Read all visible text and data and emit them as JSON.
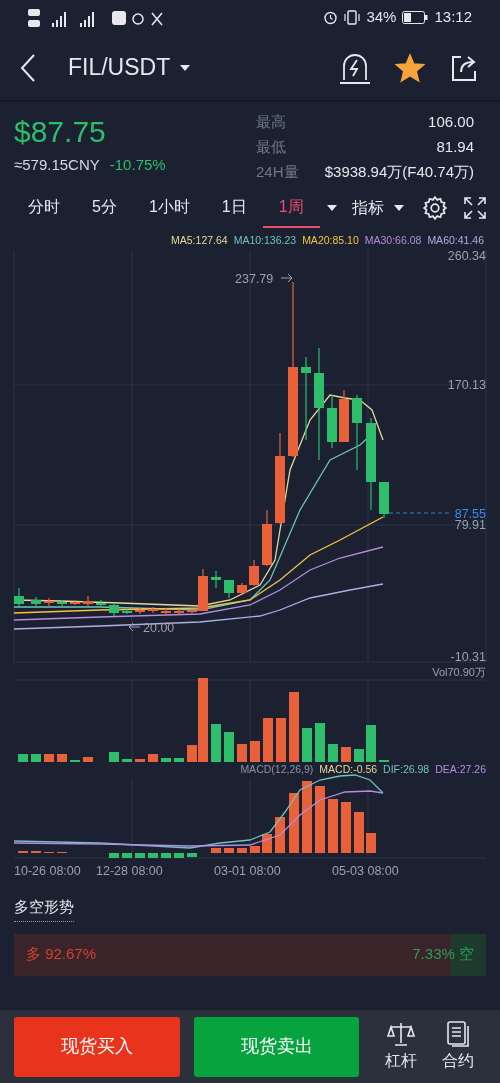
{
  "status_bar": {
    "battery": "34%",
    "time": "13:12"
  },
  "header": {
    "pair": "FIL/USDT",
    "favorite": true
  },
  "price": {
    "last": "$87.75",
    "cny": "≈579.15CNY",
    "change": "-10.75%"
  },
  "stats": [
    {
      "label": "最高",
      "value": "106.00"
    },
    {
      "label": "最低",
      "value": "81.94"
    },
    {
      "label": "24H量",
      "value": "$3938.94万(F40.74万)"
    }
  ],
  "timeframes": [
    {
      "label": "分时",
      "selected": false
    },
    {
      "label": "5分",
      "selected": false
    },
    {
      "label": "1小时",
      "selected": false
    },
    {
      "label": "1日",
      "selected": false
    },
    {
      "label": "1周",
      "selected": true
    }
  ],
  "indicator_menu": "指标",
  "chart": {
    "ma_legend": [
      {
        "label": "MA5:127.64",
        "color": "#e3d99a"
      },
      {
        "label": "MA10:136.23",
        "color": "#6fc3b8"
      },
      {
        "label": "MA20:85.10",
        "color": "#f5c342"
      },
      {
        "label": "MA30:66.08",
        "color": "#b48ce0"
      },
      {
        "label": "MA60:41.46",
        "color": "#aab0e0"
      }
    ],
    "price_axis": [
      "260.34",
      "170.13",
      "79.91",
      "-10.31"
    ],
    "high_marker": "237.79",
    "low_marker": "20.00",
    "current_price": "87.55",
    "volume_label": "Vol70.90万",
    "macd_legend": [
      {
        "label": "MACD(12,26,9)",
        "color": "#8a93a6"
      },
      {
        "label": "MACD:-0.56",
        "color": "#e3d99a"
      },
      {
        "label": "DIF:26.98",
        "color": "#6fc3b8"
      },
      {
        "label": "DEA:27.26",
        "color": "#b48ce0"
      }
    ],
    "time_axis": [
      "10-26 08:00",
      "12-28 08:00",
      "03-01 08:00",
      "05-03 08:00"
    ]
  },
  "sentiment": {
    "title": "多空形势",
    "long_label": "多",
    "long_pct": "92.67%",
    "short_pct": "7.33%",
    "short_label": "空",
    "level": 0.9267
  },
  "bottom_bar": {
    "buy": "现货买入",
    "sell": "现货卖出",
    "shortcuts": [
      {
        "label": "杠杆",
        "kind": "scale"
      },
      {
        "label": "合约",
        "kind": "document"
      }
    ]
  }
}
